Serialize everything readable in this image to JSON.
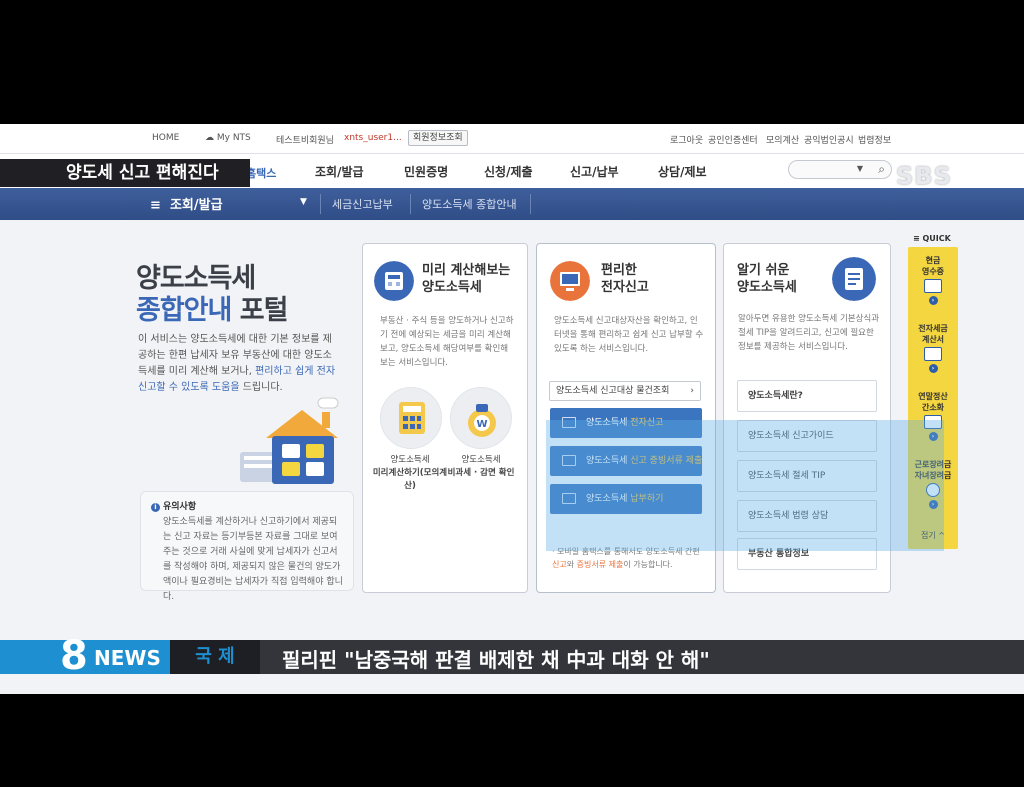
{
  "broadcast": {
    "headline": "양도세 신고 편해진다",
    "network": "SBS",
    "news_logo_num": "8",
    "news_logo_word": "NEWS",
    "category": "국 제",
    "ticker": "필리핀 \"남중국해 판결 배제한 채 中과 대화 안 해\""
  },
  "topbar": {
    "home": "HOME",
    "mynts": "My NTS",
    "user_text": "테스트비회원님",
    "user_id": "xnts_user1...",
    "member_btn": "회원정보조회",
    "right_links": [
      "로그아웃",
      "공인인증센터",
      "모의계산",
      "공익법인공시",
      "법령정보"
    ]
  },
  "gnb": {
    "logo_fragment": "홈택스",
    "items": [
      "조회/발급",
      "민원증명",
      "신청/제출",
      "신고/납부",
      "상담/제보"
    ]
  },
  "subnav": {
    "menu": "조회/발급",
    "crumbs": [
      "세금신고납부",
      "양도소득세 종합안내"
    ]
  },
  "hero": {
    "title_line1": "양도소득세",
    "title_line2_blue": "종합안내",
    "title_line2_dark": "포털",
    "desc_plain": "이 서비스는 양도소득세에 대한 기본 정보를 제공하는 한편 납세자 보유 부동산에 대한 양도소득세를 미리 계산해 보거나, ",
    "desc_highlight": "편리하고 쉽게 전자신고할 수 있도록 도움을",
    "desc_end": " 드립니다."
  },
  "notice": {
    "title": "유의사항",
    "text": "양도소득세를 계산하거나 신고하기에서 제공되는 신고 자료는 등기부등본 자료를 그대로 보여주는 것으로 거래 사실에 맞게 납세자가 신고서를 작성해야 하며, 제공되지 않은 물건의 양도가액이나 필요경비는 납세자가 직접 입력해야 합니다."
  },
  "card1": {
    "title": "미리 계산해보는\n양도소득세",
    "desc": "부동산 · 주식 등을 양도하거나 신고하기 전에 예상되는 세금을 미리 계산해 보고, 양도소득세 해당여부를 확인해 보는 서비스입니다.",
    "btn1_l1": "양도소득세",
    "btn1_l2": "미리계산하기(모의계산)",
    "btn2_l1": "양도소득세",
    "btn2_l2": "비과세 · 감면 확인"
  },
  "card2": {
    "title": "편리한\n전자신고",
    "desc": "양도소득세 신고대상자산을 확인하고, 인터넷을 통해 편리하고 쉽게 신고 납부할 수 있도록 하는 서비스입니다.",
    "select": "양도소득세 신고대상 물건조회",
    "btn1_plain": "양도소득세 ",
    "btn1_accent": "전자신고",
    "btn2_plain": "양도소득세 ",
    "btn2_accent": "신고 증빙서류 제출",
    "btn3_plain": "양도소득세 ",
    "btn3_accent": "납부하기",
    "note_plain1": "· 모바일 홈택스를 통해서도 양도소득세 간편",
    "note_orange1": "신고",
    "note_mid": "와 ",
    "note_orange2": "증빙서류 제출",
    "note_end": "이 가능합니다."
  },
  "card3": {
    "title": "알기 쉬운\n양도소득세",
    "desc": "알아두면 유용한 양도소득세 기본상식과 절세 TIP을 알려드리고, 신고에 필요한 정보를 제공하는 서비스입니다.",
    "items": [
      "양도소득세란?",
      "양도소득세 신고가이드",
      "양도소득세 절세 TIP",
      "양도소득세 법령 상담",
      "부동산 통합정보"
    ]
  },
  "quick": {
    "label": "QUICK",
    "items": [
      "현금\n영수증",
      "전자세금\n계산서",
      "연말정산\n간소화",
      "근로장려금\n자녀장려금"
    ],
    "close": "접기"
  },
  "colors": {
    "brand_blue": "#3b68b6",
    "nav_blue": "#2f4d87",
    "button_blue": "#3b75c0",
    "quick_yellow": "#f4d640",
    "news_blue": "#1e8fd0"
  }
}
